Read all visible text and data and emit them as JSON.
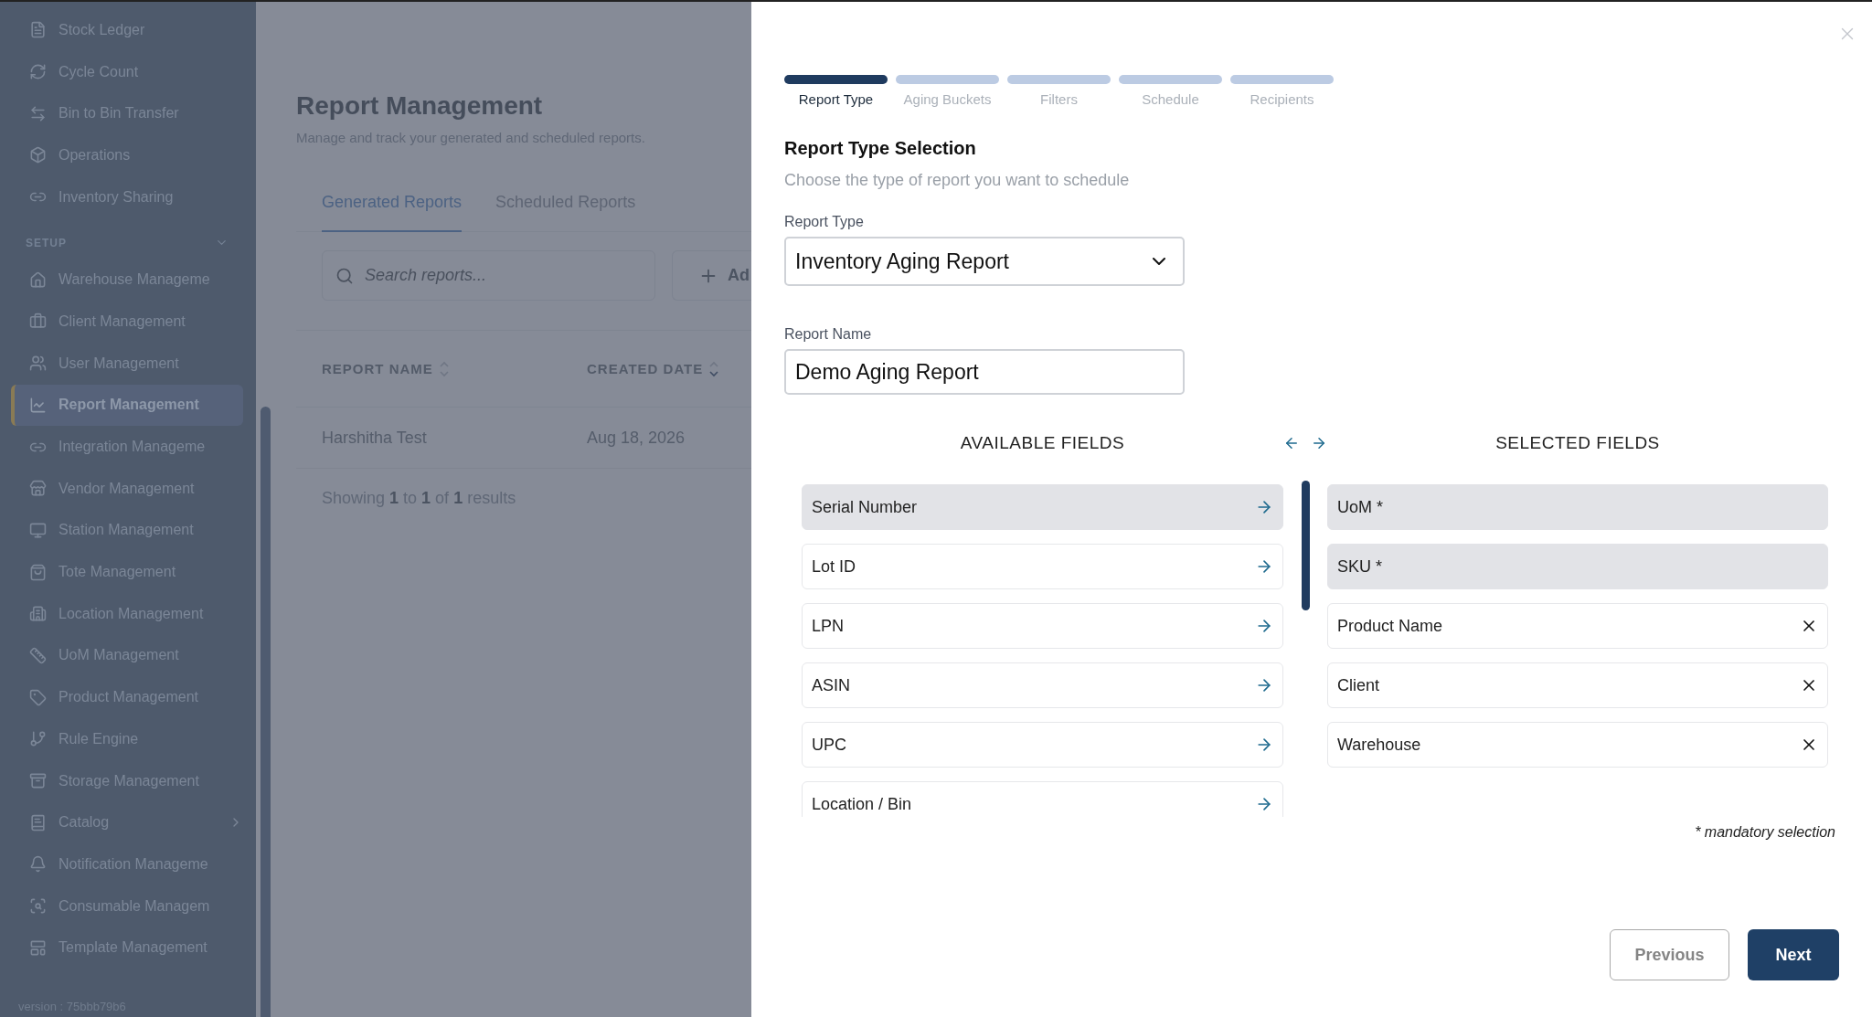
{
  "sidebar": {
    "items": [
      {
        "label": "Stock Ledger",
        "selected": false
      },
      {
        "label": "Cycle Count",
        "selected": false
      },
      {
        "label": "Bin to Bin Transfer",
        "selected": false
      },
      {
        "label": "Operations",
        "selected": false
      },
      {
        "label": "Inventory Sharing",
        "selected": false
      }
    ],
    "section": {
      "title": "SETUP",
      "expanded": true,
      "items": [
        {
          "label": "Warehouse Manageme",
          "selected": false,
          "kind": "link"
        },
        {
          "label": "Client Management",
          "selected": false,
          "kind": "link"
        },
        {
          "label": "User Management",
          "selected": false,
          "kind": "link"
        },
        {
          "label": "Report Management",
          "selected": true,
          "kind": "link"
        },
        {
          "label": "Integration Manageme",
          "selected": false,
          "kind": "link"
        },
        {
          "label": "Vendor Management",
          "selected": false,
          "kind": "link"
        },
        {
          "label": "Station Management",
          "selected": false,
          "kind": "link"
        },
        {
          "label": "Tote Management",
          "selected": false,
          "kind": "link"
        },
        {
          "label": "Location Management",
          "selected": false,
          "kind": "link"
        },
        {
          "label": "UoM Management",
          "selected": false,
          "kind": "link"
        },
        {
          "label": "Product Management",
          "selected": false,
          "kind": "link"
        },
        {
          "label": "Rule Engine",
          "selected": false,
          "kind": "link"
        },
        {
          "label": "Storage Management",
          "selected": false,
          "kind": "link"
        },
        {
          "label": "Catalog",
          "selected": false,
          "kind": "group",
          "expanded": false
        },
        {
          "label": "Notification Manageme",
          "selected": false,
          "kind": "link"
        },
        {
          "label": "Consumable Managem",
          "selected": false,
          "kind": "link"
        },
        {
          "label": "Template Management",
          "selected": false,
          "kind": "link"
        }
      ]
    },
    "version": "version : 75bbb79b6"
  },
  "page": {
    "title": "Report Management",
    "subtitle": "Manage and track your generated and scheduled reports.",
    "tabs": [
      {
        "label": "Generated Reports",
        "selected": true
      },
      {
        "label": "Scheduled Reports",
        "selected": false
      }
    ],
    "search": {
      "placeholder": "Search reports..."
    },
    "add_button": "Ad",
    "table": {
      "columns": [
        {
          "label": "REPORT NAME",
          "sorted": false
        },
        {
          "label": "CREATED DATE",
          "sorted": true
        }
      ],
      "rows": [
        [
          "Harshitha Test",
          "Aug 18, 2026"
        ]
      ]
    },
    "footer": "Showing **1** to **1** of **1** results"
  },
  "drawer": {
    "steps": [
      {
        "label": "Report Type",
        "selected": true
      },
      {
        "label": "Aging Buckets",
        "selected": false
      },
      {
        "label": "Filters",
        "selected": false
      },
      {
        "label": "Schedule",
        "selected": false
      },
      {
        "label": "Recipients",
        "selected": false
      }
    ],
    "title": "Report Type Selection",
    "subtitle": "Choose the type of report you want to schedule",
    "report_type": {
      "label": "Report Type",
      "value": "Inventory Aging Report"
    },
    "report_name": {
      "label": "Report Name",
      "value": "Demo Aging Report"
    },
    "available_fields": {
      "title": "AVAILABLE FIELDS",
      "items": [
        {
          "label": "Serial Number",
          "highlighted": true
        },
        {
          "label": "Lot ID",
          "highlighted": false
        },
        {
          "label": "LPN",
          "highlighted": false
        },
        {
          "label": "ASIN",
          "highlighted": false
        },
        {
          "label": "UPC",
          "highlighted": false
        },
        {
          "label": "Location / Bin",
          "highlighted": false
        }
      ]
    },
    "selected_fields": {
      "title": "SELECTED FIELDS",
      "items": [
        {
          "label": "UoM *",
          "mandatory": true
        },
        {
          "label": "SKU *",
          "mandatory": true
        },
        {
          "label": "Product Name",
          "mandatory": false
        },
        {
          "label": "Client",
          "mandatory": false
        },
        {
          "label": "Warehouse",
          "mandatory": false
        }
      ]
    },
    "note": "* mandatory selection",
    "buttons": {
      "previous": "Previous",
      "next": "Next"
    }
  }
}
